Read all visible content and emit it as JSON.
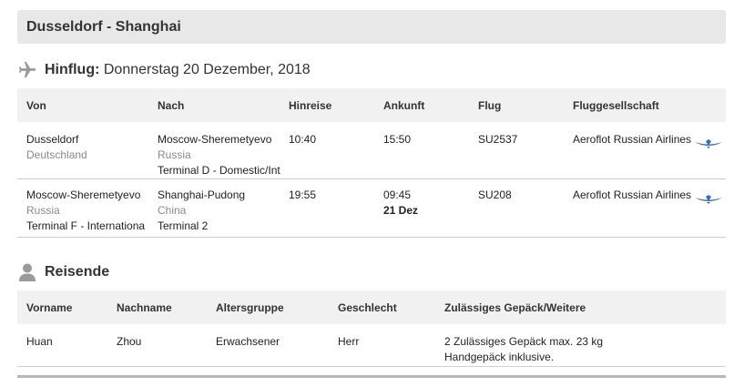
{
  "route": {
    "title": "Dusseldorf - Shanghai"
  },
  "outbound": {
    "label": "Hinflug:",
    "date": "Donnerstag 20 Dezember, 2018",
    "columns": [
      "Von",
      "Nach",
      "Hinreise",
      "Ankunft",
      "Flug",
      "Fluggesellschaft"
    ],
    "legs": [
      {
        "from_city": "Dusseldorf",
        "from_country": "Deutschland",
        "from_terminal": "",
        "to_city": "Moscow-Sheremetyevo",
        "to_country": "Russia",
        "to_terminal": "Terminal D - Domestic/Int",
        "departure": "10:40",
        "arrival": "15:50",
        "arrival_day": "",
        "flight": "SU2537",
        "airline": "Aeroflot Russian Airlines"
      },
      {
        "from_city": "Moscow-Sheremetyevo",
        "from_country": "Russia",
        "from_terminal": "Terminal F - Internationa",
        "to_city": "Shanghai-Pudong",
        "to_country": "China",
        "to_terminal": "Terminal 2",
        "departure": "19:55",
        "arrival": "09:45",
        "arrival_day": "21 Dez",
        "flight": "SU208",
        "airline": "Aeroflot Russian Airlines"
      }
    ]
  },
  "travelers": {
    "title": "Reisende",
    "columns": [
      "Vorname",
      "Nachname",
      "Altersgruppe",
      "Geschlecht",
      "Zulässiges Gepäck/Weitere"
    ],
    "rows": [
      {
        "first_name": "Huan",
        "last_name": "Zhou",
        "age_group": "Erwachsener",
        "gender": "Herr",
        "baggage_line1": "2 Zulässiges Gepäck max. 23 kg",
        "baggage_line2": "Handgepäck inklusive."
      }
    ]
  },
  "icons": {
    "flight": "airplane-icon",
    "travelers": "person-icon",
    "airline": "aeroflot-logo"
  },
  "colors": {
    "header_bg": "#e8e8e8",
    "table_header_bg": "#f1f1f1",
    "muted_text": "#8a8a8a",
    "logo_blue": "#3a6db5"
  }
}
